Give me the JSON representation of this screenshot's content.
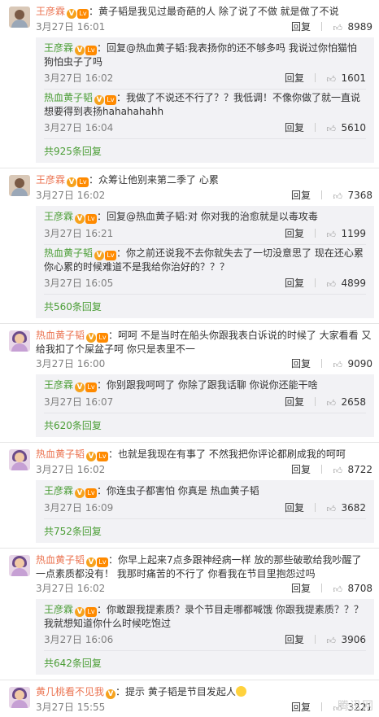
{
  "comments": [
    {
      "author": "王彦霖",
      "text": "：黄子韬是我见过最奇葩的人  除了说了不做 就是做了不说",
      "time": "3月27日 16:01",
      "reply": "回复",
      "likes": "8989",
      "replies": [
        {
          "author": "王彦霖",
          "text": "：回复@热血黄子韬:我表扬你的还不够多吗 我说过你怕猫怕狗怕虫子了吗",
          "time": "3月27日 16:02",
          "reply": "回复",
          "likes": "1601"
        },
        {
          "author": "热血黄子韬",
          "text": "：我做了不说还不行了？？我低调！不像你做了就一直说想要得到表扬hahahahahh",
          "time": "3月27日 16:04",
          "reply": "回复",
          "likes": "5610"
        }
      ],
      "total": "共925条回复"
    },
    {
      "author": "王彦霖",
      "text": "：众筹让他别来第二季了  心累",
      "time": "3月27日 16:02",
      "reply": "回复",
      "likes": "7368",
      "replies": [
        {
          "author": "王彦霖",
          "text": "：回复@热血黄子韬:对 你对我的治愈就是以毒攻毒",
          "time": "3月27日 16:21",
          "reply": "回复",
          "likes": "1199"
        },
        {
          "author": "热血黄子韬",
          "text": "：你之前还说我不去你就失去了一切没意思了 现在还心累你心累的时候难道不是我给你治好的？？？",
          "time": "3月27日 16:05",
          "reply": "回复",
          "likes": "4899"
        }
      ],
      "total": "共560条回复"
    },
    {
      "author": "热血黄子韬",
      "text": "：呵呵 不是当时在船头你跟我表白诉说的时候了 大家看看 又给我扣了个屎盆子呵 你只是表里不一",
      "time": "3月27日 16:00",
      "reply": "回复",
      "likes": "9090",
      "replies": [
        {
          "author": "王彦霖",
          "text": "：你别跟我呵呵了 你除了跟我话聊 你说你还能干啥",
          "time": "3月27日 16:07",
          "reply": "回复",
          "likes": "2658"
        }
      ],
      "total": "共620条回复"
    },
    {
      "author": "热血黄子韬",
      "text": "：也就是我现在有事了 不然我把你评论都刷成我的呵呵",
      "time": "3月27日 16:02",
      "reply": "回复",
      "likes": "8722",
      "replies": [
        {
          "author": "王彦霖",
          "text": "：你连虫子都害怕 你真是 热血黄子韬",
          "time": "3月27日 16:09",
          "reply": "回复",
          "likes": "3682"
        }
      ],
      "total": "共752条回复"
    },
    {
      "author": "热血黄子韬",
      "text": "：你早上起来7点多跟神经病一样 放的那些破歌给我吵醒了 一点素质都没有！ 我那时痛苦的不行了 你看我在节目里抱怨过吗",
      "time": "3月27日 16:02",
      "reply": "回复",
      "likes": "8708",
      "replies": [
        {
          "author": "王彦霖",
          "text": "：你敢跟我提素质？录个节目走哪都喊饿 你跟我提素质？？？我就想知道你什么时候吃饱过",
          "time": "3月27日 16:06",
          "reply": "回复",
          "likes": "3906"
        }
      ],
      "total": "共642条回复"
    },
    {
      "author": "黄几桃看不见我",
      "text": "：提示 黄子韬是节目发起人",
      "time": "3月27日 15:55",
      "reply": "回复",
      "likes": "3221",
      "replies": [],
      "total": ""
    }
  ],
  "badges": {
    "v": "V",
    "level": "Lv"
  },
  "icons": {
    "like": "thumbs-up-icon"
  },
  "colors": {
    "author": "#eb7350",
    "link_green": "#4a9d35",
    "reply_bg": "#f2f2f5"
  },
  "watermark": "腾讯网"
}
